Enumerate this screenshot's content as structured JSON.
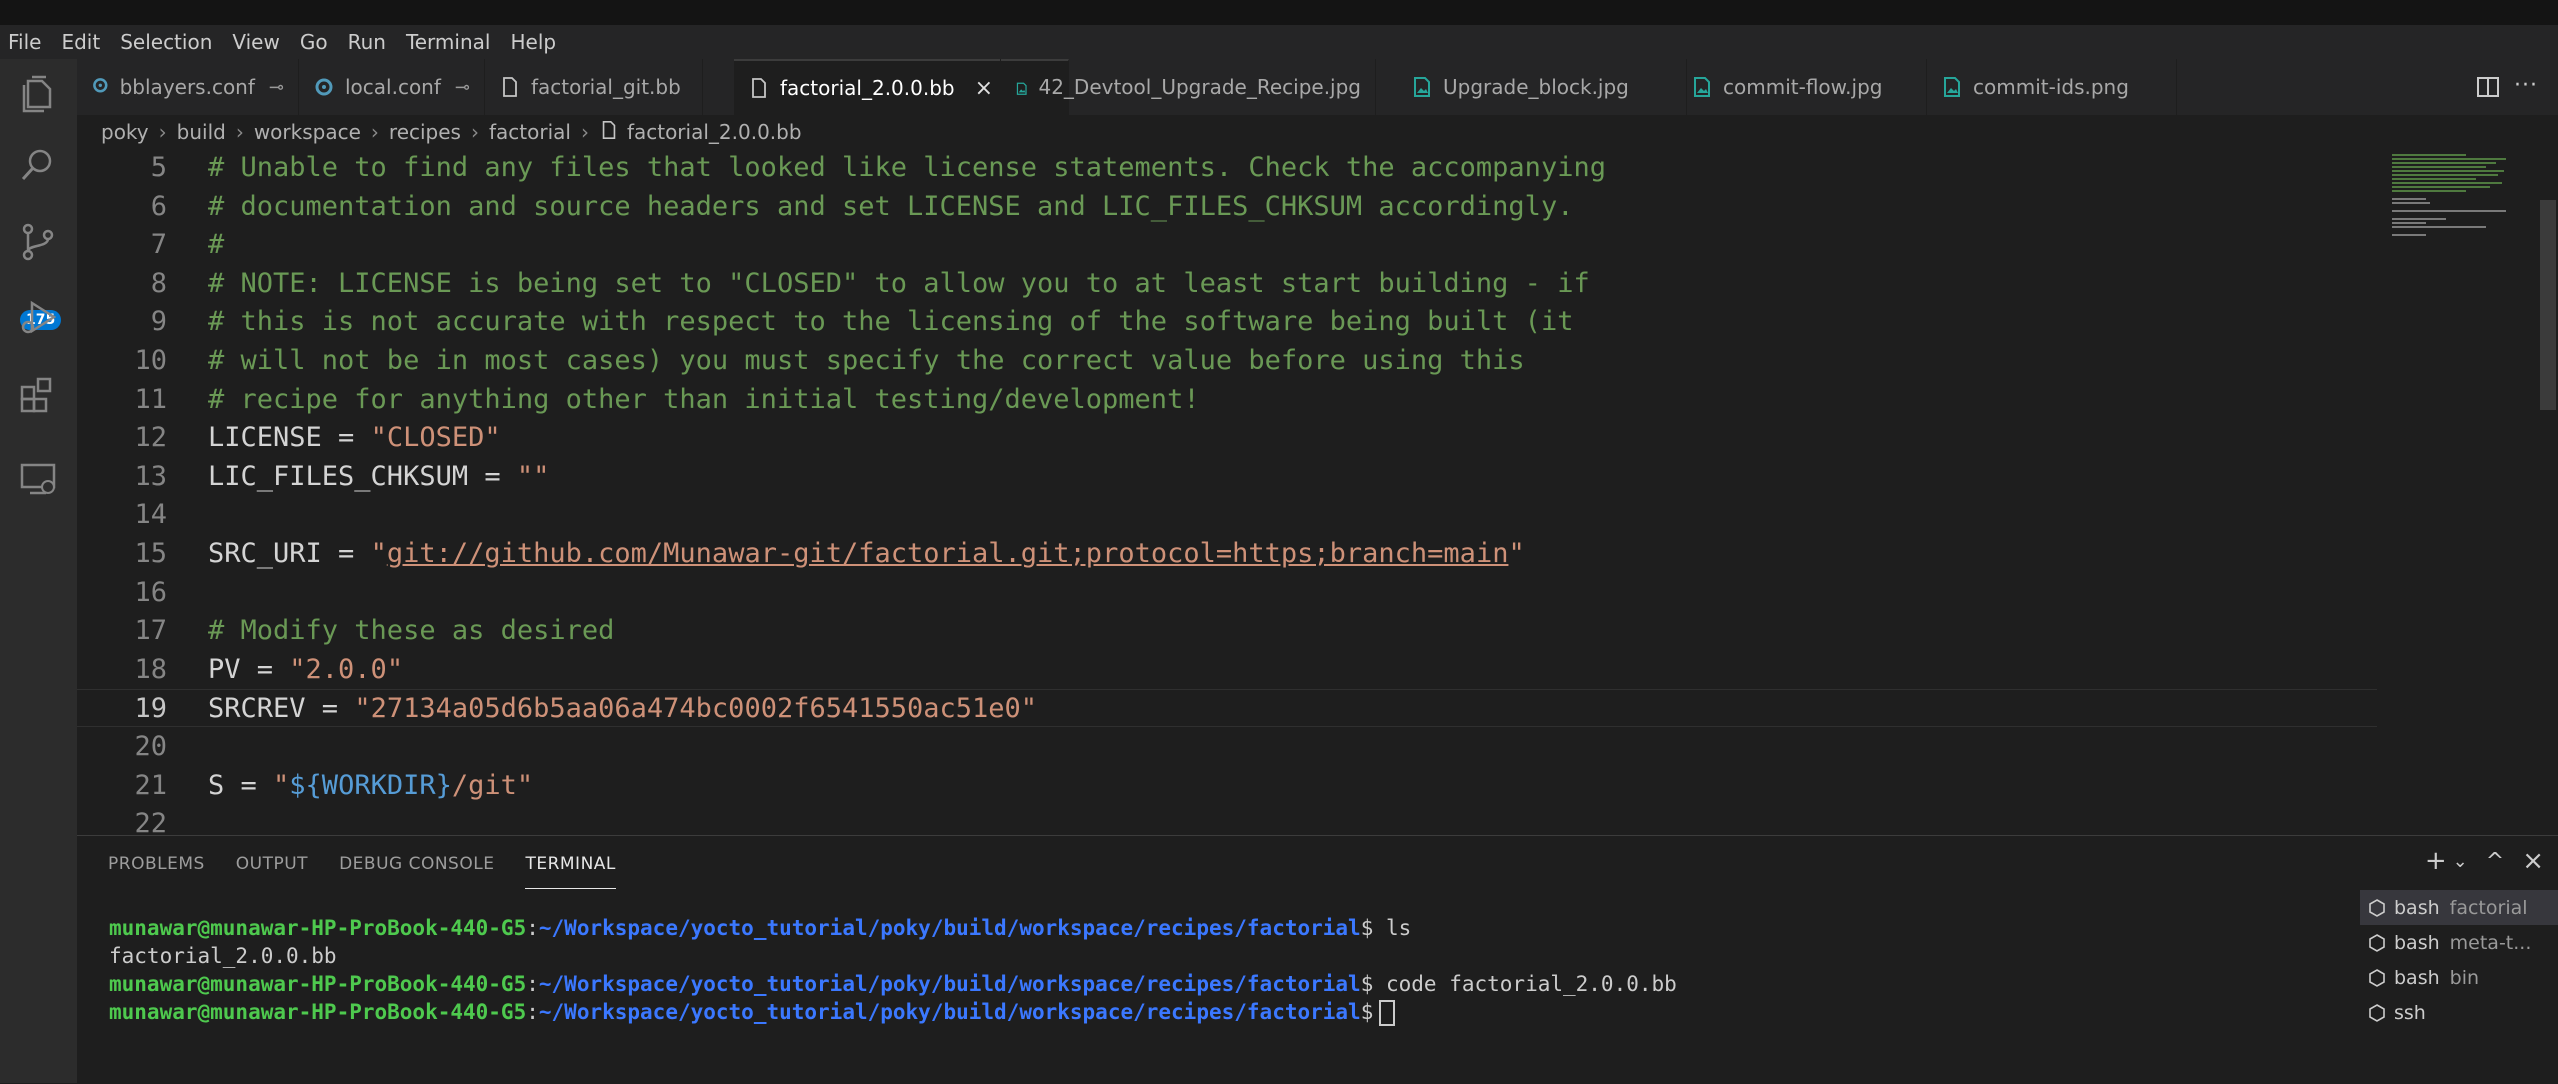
{
  "menu": [
    "File",
    "Edit",
    "Selection",
    "View",
    "Go",
    "Run",
    "Terminal",
    "Help"
  ],
  "activity": {
    "scm_badge": "175"
  },
  "tabs": [
    {
      "label": "bblayers.conf",
      "icon": "gear-icon",
      "pinned": true
    },
    {
      "label": "local.conf",
      "icon": "gear-icon",
      "pinned": true
    },
    {
      "label": "factorial_git.bb",
      "icon": "file-icon",
      "pinned": false
    },
    {
      "label": "factorial_2.0.0.bb",
      "icon": "file-icon",
      "active": true,
      "close": "×"
    },
    {
      "label": "42_Devtool_Upgrade_Recipe.jpg",
      "icon": "image-icon"
    },
    {
      "label": "Upgrade_block.jpg",
      "icon": "image-icon"
    },
    {
      "label": "commit-flow.jpg",
      "icon": "image-icon"
    },
    {
      "label": "commit-ids.png",
      "icon": "image-icon"
    }
  ],
  "breadcrumb": [
    "poky",
    "build",
    "workspace",
    "recipes",
    "factorial",
    "factorial_2.0.0.bb"
  ],
  "editor": {
    "lines": [
      {
        "n": "5",
        "parts": [
          [
            "cm",
            "# Unable to find any files that looked like license statements. Check the accompanying"
          ]
        ]
      },
      {
        "n": "6",
        "parts": [
          [
            "cm",
            "# documentation and source headers and set LICENSE and LIC_FILES_CHKSUM accordingly."
          ]
        ]
      },
      {
        "n": "7",
        "parts": [
          [
            "cm",
            "#"
          ]
        ]
      },
      {
        "n": "8",
        "parts": [
          [
            "cm",
            "# NOTE: LICENSE is being set to \"CLOSED\" to allow you to at least start building - if"
          ]
        ]
      },
      {
        "n": "9",
        "parts": [
          [
            "cm",
            "# this is not accurate with respect to the licensing of the software being built (it"
          ]
        ]
      },
      {
        "n": "10",
        "parts": [
          [
            "cm",
            "# will not be in most cases) you must specify the correct value before using this"
          ]
        ]
      },
      {
        "n": "11",
        "parts": [
          [
            "cm",
            "# recipe for anything other than initial testing/development!"
          ]
        ]
      },
      {
        "n": "12",
        "parts": [
          [
            "tx",
            "LICENSE = "
          ],
          [
            "str",
            "\"CLOSED\""
          ]
        ]
      },
      {
        "n": "13",
        "parts": [
          [
            "tx",
            "LIC_FILES_CHKSUM = "
          ],
          [
            "str",
            "\"\""
          ]
        ]
      },
      {
        "n": "14",
        "parts": []
      },
      {
        "n": "15",
        "parts": [
          [
            "tx",
            "SRC_URI = "
          ],
          [
            "str",
            "\""
          ],
          [
            "url",
            "git://github.com/Munawar-git/factorial.git;protocol=https;branch=main"
          ],
          [
            "str",
            "\""
          ]
        ]
      },
      {
        "n": "16",
        "parts": []
      },
      {
        "n": "17",
        "parts": [
          [
            "cm",
            "# Modify these as desired"
          ]
        ]
      },
      {
        "n": "18",
        "parts": [
          [
            "tx",
            "PV = "
          ],
          [
            "str",
            "\"2.0.0\""
          ]
        ]
      },
      {
        "n": "19",
        "parts": [
          [
            "tx",
            "SRCREV = "
          ],
          [
            "str",
            "\"27134a05d6b5aa06a474bc0002f6541550ac51e0\""
          ]
        ],
        "current": true
      },
      {
        "n": "20",
        "parts": []
      },
      {
        "n": "21",
        "parts": [
          [
            "tx",
            "S = "
          ],
          [
            "str",
            "\""
          ],
          [
            "var",
            "${WORKDIR}"
          ],
          [
            "str",
            "/git\""
          ]
        ]
      },
      {
        "n": "22",
        "parts": []
      }
    ]
  },
  "panel": {
    "tabs": [
      "PROBLEMS",
      "OUTPUT",
      "DEBUG CONSOLE",
      "TERMINAL"
    ],
    "active_tab": "TERMINAL",
    "actions": {
      "add": "+",
      "dropdown": "⌄",
      "maximize": "^",
      "close": "×"
    }
  },
  "terminal": {
    "user": "munawar@munawar-HP-ProBook-440-G5",
    "path": "~/Workspace/yocto_tutorial/poky/build/workspace/recipes/factorial",
    "cmd1": " ls",
    "out1": "factorial_2.0.0.bb",
    "cmd2": " code factorial_2.0.0.bb",
    "cmd3": " ",
    "sep": ":",
    "prompt_end": "$"
  },
  "terminal_list": [
    {
      "name": "bash",
      "sub": "factorial",
      "active": true
    },
    {
      "name": "bash",
      "sub": "meta-t..."
    },
    {
      "name": "bash",
      "sub": "bin"
    },
    {
      "name": "ssh",
      "sub": ""
    }
  ]
}
